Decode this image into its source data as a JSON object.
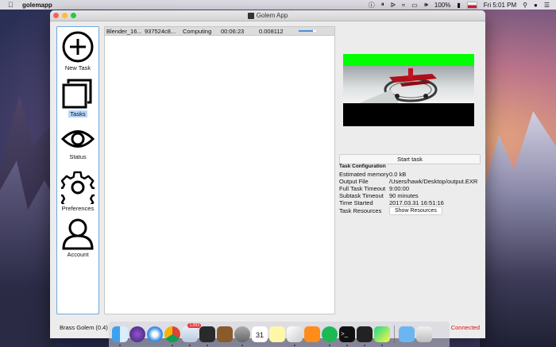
{
  "menubar": {
    "app_name": "golemapp",
    "battery": "100%",
    "clock": "Fri 5:01 PM"
  },
  "window": {
    "title": "Golem App",
    "status_left": "Brass Golem (0.4)",
    "status_right": "Connected"
  },
  "sidebar": {
    "items": [
      {
        "label": "New Task",
        "icon": "plus-circle-icon"
      },
      {
        "label": "Tasks",
        "icon": "tasks-icon"
      },
      {
        "label": "Status",
        "icon": "eye-icon"
      },
      {
        "label": "Preferences",
        "icon": "gear-icon"
      },
      {
        "label": "Account",
        "icon": "user-icon"
      }
    ]
  },
  "tasks": [
    {
      "name": "Blender_16...",
      "id": "937524c8...",
      "status": "Computing",
      "time": "00:06:23",
      "cost": "0.008112",
      "progress": 0.8
    }
  ],
  "panel": {
    "start_label": "Start task",
    "config_header": "Task Configuration",
    "rows": [
      {
        "key": "Estimated memory",
        "value": "0.0 kB"
      },
      {
        "key": "Output File",
        "value": "/Users/hawk/Desktop/output.EXR"
      },
      {
        "key": "Full Task Timeout",
        "value": "9:00:00"
      },
      {
        "key": "Subtask Timeout",
        "value": "90 minutes"
      },
      {
        "key": "Time Started",
        "value": "2017.03.31  16:51:16"
      }
    ],
    "resources_label": "Task Resources",
    "show_resources_label": "Show Resources"
  },
  "dock": {
    "mail_badge": "1,093",
    "calendar_day": "31"
  },
  "colors": {
    "selection": "#b5d5ff",
    "connected": "#dd1111",
    "preview_green": "#00ff00"
  }
}
